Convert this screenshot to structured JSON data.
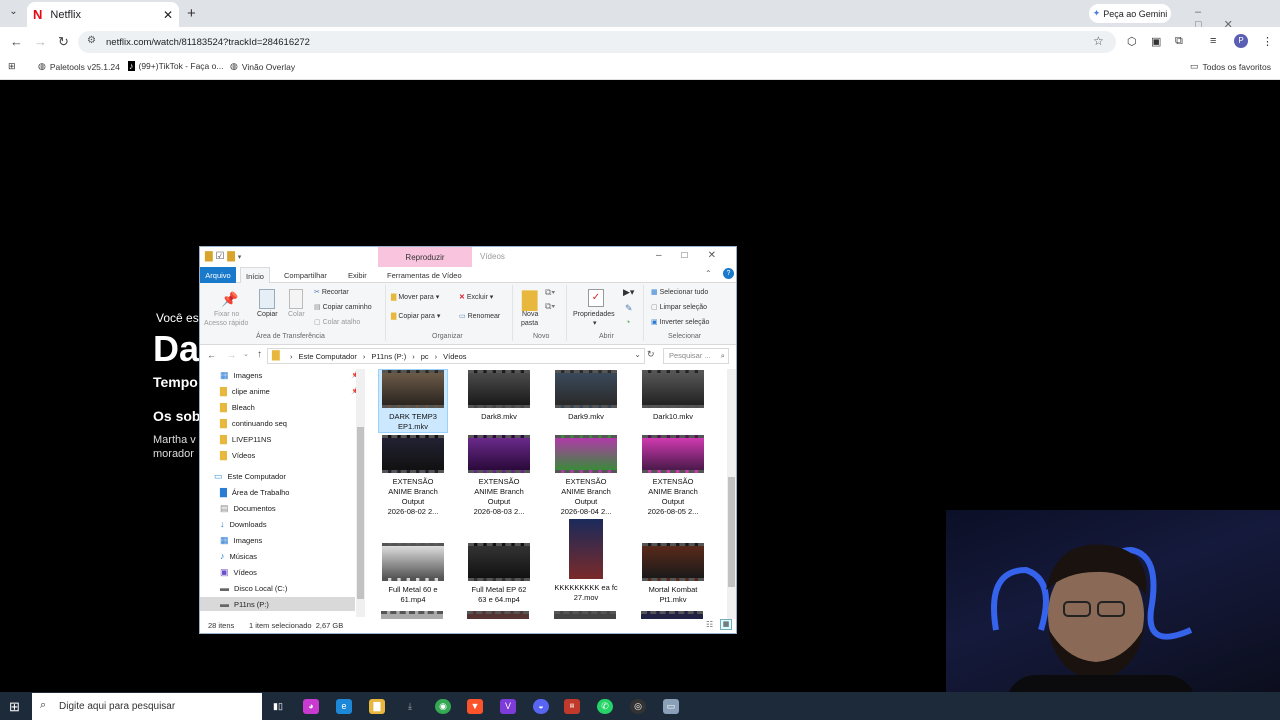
{
  "browser": {
    "tab_title": "Netflix",
    "gemini_label": "Peça ao Gemini",
    "url": "netflix.com/watch/81183524?trackId=284616272",
    "bookmarks": [
      "Paletools v25.1.24",
      "(99+)TikTok - Faça o...",
      "Vinão Overlay"
    ],
    "all_bookmarks": "Todos os favoritos"
  },
  "netflix": {
    "line1": "Você es",
    "title": "Da",
    "temp": "Tempo",
    "os_sob": "Os sob",
    "desc1": "Martha v",
    "desc2": "morador"
  },
  "explorer": {
    "reproduzir": "Reproduzir",
    "window_title": "Vídeos",
    "tabs": {
      "arquivo": "Arquivo",
      "inicio": "Início",
      "compartilhar": "Compartilhar",
      "exibir": "Exibir",
      "ferramentas": "Ferramentas de Vídeo"
    },
    "ribbon": {
      "fixar1": "Fixar no",
      "fixar2": "Acesso rápido",
      "copiar": "Copiar",
      "colar": "Colar",
      "recortar": "Recortar",
      "copiar_caminho": "Copiar caminho",
      "colar_atalho": "Colar atalho",
      "grp_transferencia": "Área de Transferência",
      "mover_para": "Mover para",
      "copiar_para": "Copiar para",
      "excluir": "Excluir",
      "renomear": "Renomear",
      "grp_organizar": "Organizar",
      "nova1": "Nova",
      "nova2": "pasta",
      "grp_novo": "Novo",
      "propriedades": "Propriedades",
      "grp_abrir": "Abrir",
      "selecionar_tudo": "Selecionar tudo",
      "limpar_selecao": "Limpar seleção",
      "inverter_selecao": "Inverter seleção",
      "grp_selecionar": "Selecionar"
    },
    "path": [
      "Este Computador",
      "P11ns (P:)",
      "pc",
      "Vídeos"
    ],
    "search_placeholder": "Pesquisar ...",
    "nav": [
      "Imagens",
      "clipe anime",
      "Bleach",
      "continuando seq",
      "LIVEP11NS",
      "Vídeos",
      "Este Computador",
      "Área de Trabalho",
      "Documentos",
      "Downloads",
      "Imagens",
      "Músicas",
      "Vídeos",
      "Disco Local (C:)",
      "P11ns (P:)"
    ],
    "files": [
      {
        "l1": "DARK TEMP3",
        "l2": "EP1.mkv",
        "l3": "",
        "l4": ""
      },
      {
        "l1": "Dark8.mkv",
        "l2": "",
        "l3": "",
        "l4": ""
      },
      {
        "l1": "Dark9.mkv",
        "l2": "",
        "l3": "",
        "l4": ""
      },
      {
        "l1": "Dark10.mkv",
        "l2": "",
        "l3": "",
        "l4": ""
      },
      {
        "l1": "EXTENSÃO",
        "l2": "ANIME Branch",
        "l3": "Output",
        "l4": "2026-08-02 2..."
      },
      {
        "l1": "EXTENSÃO",
        "l2": "ANIME Branch",
        "l3": "Output",
        "l4": "2026-08-03 2..."
      },
      {
        "l1": "EXTENSÃO",
        "l2": "ANIME Branch",
        "l3": "Output",
        "l4": "2026-08-04 2..."
      },
      {
        "l1": "EXTENSÃO",
        "l2": "ANIME Branch",
        "l3": "Output",
        "l4": "2026-08-05 2..."
      },
      {
        "l1": "Full Metal 60 e",
        "l2": "61.mp4",
        "l3": "",
        "l4": ""
      },
      {
        "l1": "Full Metal EP 62",
        "l2": "63 e 64.mp4",
        "l3": "",
        "l4": ""
      },
      {
        "l1": "KKKKKKKKK ea fc",
        "l2": "27.mov",
        "l3": "",
        "l4": ""
      },
      {
        "l1": "Mortal Kombat",
        "l2": "Pt1.mkv",
        "l3": "",
        "l4": ""
      }
    ],
    "status_items": "28 itens",
    "status_selected": "1 item selecionado  2,67 GB"
  },
  "taskbar": {
    "search_placeholder": "Digite aqui para pesquisar"
  },
  "colors": {
    "netflix_red": "#e50914",
    "arquivo_tab": "#1979ca",
    "reproduzir_bg": "#f9c5de",
    "taskbar": "#1c2a3a"
  }
}
